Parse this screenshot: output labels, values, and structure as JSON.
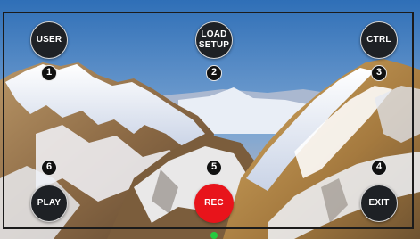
{
  "buttons": {
    "user": "USER",
    "load_setup": "LOAD\nSETUP",
    "ctrl": "CTRL",
    "play": "PLAY",
    "rec": "REC",
    "exit": "EXIT"
  },
  "markers": {
    "m1": "1",
    "m2": "2",
    "m3": "3",
    "m4": "4",
    "m5": "5",
    "m6": "6"
  },
  "colors": {
    "button_bg": "#1e2125",
    "rec_button": "#e8141b",
    "status_dot": "#27c93f"
  }
}
